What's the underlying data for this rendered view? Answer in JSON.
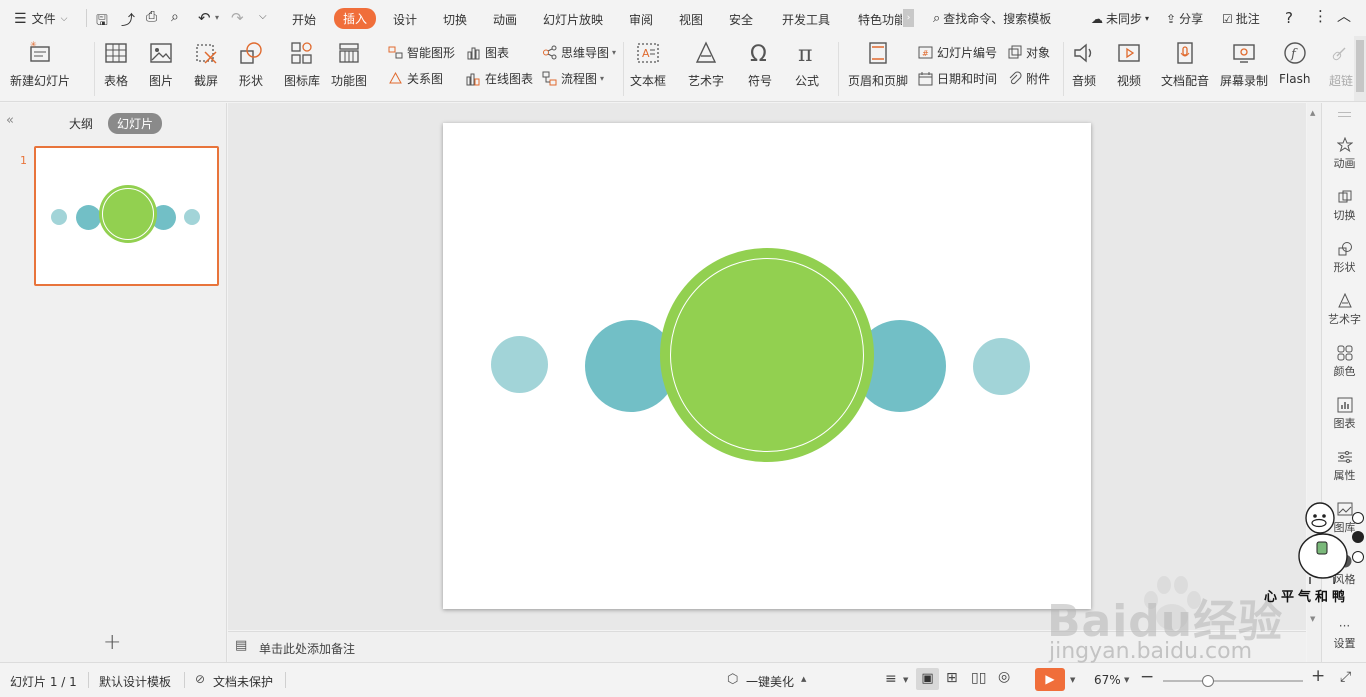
{
  "menubar": {
    "file": "文件",
    "tabs": [
      "开始",
      "插入",
      "设计",
      "切换",
      "动画",
      "幻灯片放映",
      "审阅",
      "视图",
      "安全",
      "开发工具",
      "特色功能"
    ],
    "active_tab": "插入",
    "search": "查找命令、搜索模板",
    "sync": "未同步",
    "share": "分享",
    "comment": "批注"
  },
  "ribbon": {
    "new_slide": "新建幻灯片",
    "table": "表格",
    "picture": "图片",
    "screenshot": "截屏",
    "shape": "形状",
    "icon_lib": "图标库",
    "func_chart": "功能图",
    "smart_art": "智能图形",
    "chart": "图表",
    "mind_map": "思维导图",
    "relation": "关系图",
    "online_chart": "在线图表",
    "flow_chart": "流程图",
    "text_box": "文本框",
    "word_art": "艺术字",
    "symbol": "符号",
    "formula": "公式",
    "header_footer": "页眉和页脚",
    "slide_number": "幻灯片编号",
    "object": "对象",
    "date_time": "日期和时间",
    "attachment": "附件",
    "audio": "音频",
    "video": "视频",
    "doc_voice": "文档配音",
    "screen_record": "屏幕录制",
    "flash": "Flash",
    "hyperlink": "超链"
  },
  "left": {
    "outline": "大纲",
    "slides": "幻灯片",
    "slide_num": "1"
  },
  "notes": {
    "placeholder": "单击此处添加备注"
  },
  "right": {
    "items": [
      "动画",
      "切换",
      "形状",
      "艺术字",
      "颜色",
      "图表",
      "属性",
      "图库",
      "风格",
      "设置"
    ]
  },
  "status": {
    "slide_info": "幻灯片 1 / 1",
    "template": "默认设计模板",
    "protect": "文档未保护",
    "beautify": "一键美化",
    "zoom": "67%"
  },
  "watermark": {
    "brand": "Baidu经验",
    "url": "jingyan.baidu.com",
    "author": "心平气和鸭"
  },
  "colors": {
    "green": "#92d050",
    "teal": "#72bfc6",
    "light_teal": "#a2d4d8",
    "active_tab": "#f06e3a",
    "slide_border": "#e8743b"
  }
}
